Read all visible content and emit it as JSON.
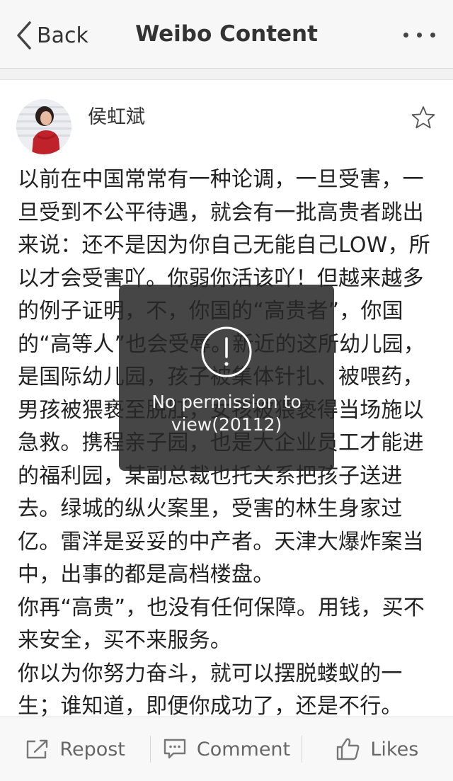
{
  "nav": {
    "back_label": "Back",
    "title": "Weibo Content"
  },
  "post": {
    "author": "侯虹斌",
    "paragraphs": [
      "以前在中国常常有一种论调，一旦受害，一旦受到不公平待遇，就会有一批高贵者跳出来说：还不是因为你自己无能自己LOW，所以才会受害吖。你弱你活该吖！但越来越多的例子证明，不，你国的“高贵者”，你国的“高等人”也会受辱。新近的这所幼儿园，是国际幼儿园，孩子被集体针扎、被喂药，男孩被猥亵至脱肛，女孩被猥亵得当场施以急救。携程亲子园，也是大企业员工才能进的福利园，某副总裁也托关系把孩子送进去。绿城的纵火案里，受害的林生身家过亿。雷洋是妥妥的中产者。天津大爆炸案当中，出事的都是高档楼盘。",
      "你再“高贵”，也没有任何保障。用钱，买不来安全，买不来服务。",
      "你以为你努力奋斗，就可以摆脱蝼蚁的一生；谁知道，即便你成功了，还是不行。"
    ]
  },
  "toast": {
    "icon": "exclamation-circle-icon",
    "message": "No permission to view(20112)"
  },
  "actions": {
    "repost": "Repost",
    "comment": "Comment",
    "likes": "Likes"
  },
  "colors": {
    "nav_background": "#f7f7f7",
    "toast_background": "#282828",
    "action_text": "#666666"
  }
}
